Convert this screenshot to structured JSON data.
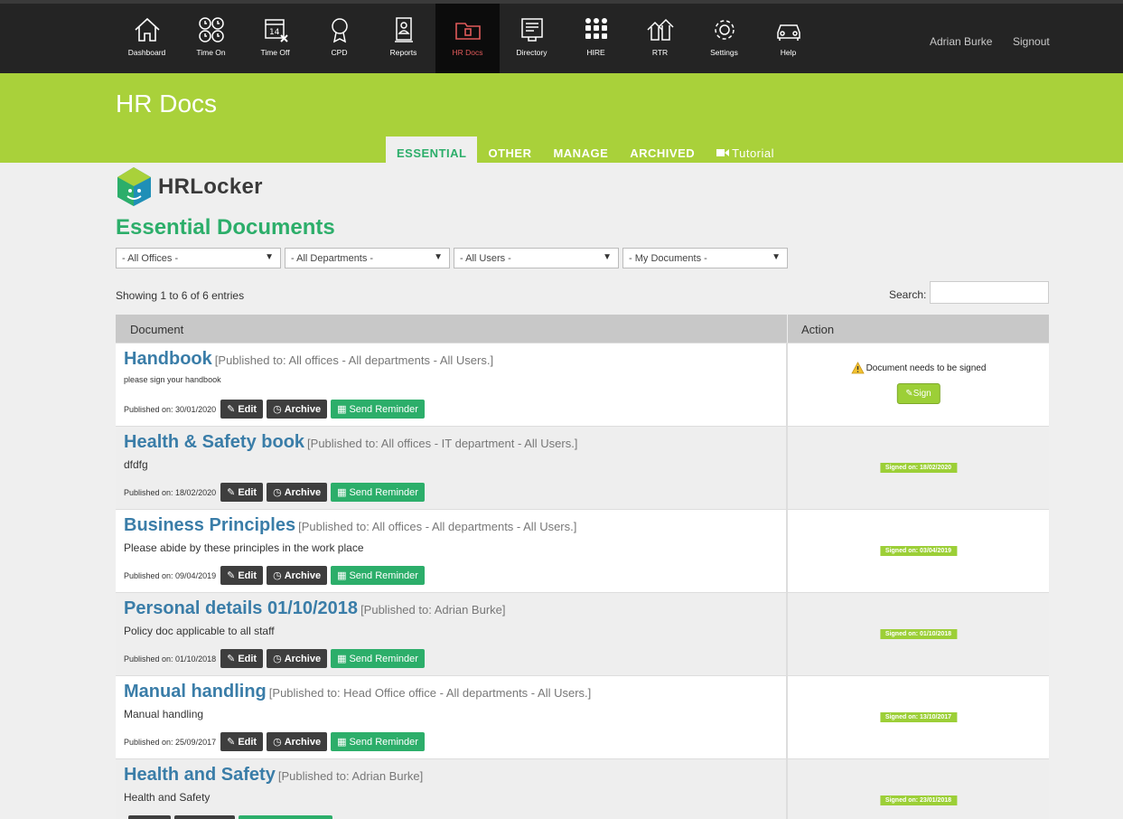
{
  "nav": {
    "items": [
      {
        "label": "Dashboard",
        "icon": "home-icon"
      },
      {
        "label": "Time On",
        "icon": "clock-icon"
      },
      {
        "label": "Time Off",
        "icon": "calendar-icon"
      },
      {
        "label": "CPD",
        "icon": "award-icon"
      },
      {
        "label": "Reports",
        "icon": "report-icon"
      },
      {
        "label": "HR Docs",
        "icon": "folder-icon"
      },
      {
        "label": "Directory",
        "icon": "directory-icon"
      },
      {
        "label": "HIRE",
        "icon": "people-icon"
      },
      {
        "label": "RTR",
        "icon": "houses-icon"
      },
      {
        "label": "Settings",
        "icon": "gear-icon"
      },
      {
        "label": "Help",
        "icon": "car-icon"
      }
    ],
    "active_index": 5,
    "active_color": "#e05a5a"
  },
  "user": {
    "name": "Adrian Burke",
    "signout": "Signout"
  },
  "header": {
    "title": "HR Docs",
    "bg_color": "#a9d13a",
    "tabs": [
      {
        "label": "ESSENTIAL",
        "active": true
      },
      {
        "label": "OTHER"
      },
      {
        "label": "MANAGE"
      },
      {
        "label": "ARCHIVED"
      },
      {
        "label": "Tutorial",
        "icon": "video-icon"
      }
    ]
  },
  "logo": {
    "text": "HRLocker"
  },
  "main": {
    "title": "Essential Documents",
    "filters": [
      "- All Offices -",
      "- All Departments -",
      "- All Users -",
      "- My Documents -"
    ],
    "showing": "Showing 1 to 6 of 6 entries",
    "search_label": "Search:",
    "search_value": "",
    "table": {
      "headers": [
        "Document",
        "Action"
      ],
      "edit_label": "Edit",
      "archive_label": "Archive",
      "reminder_label": "Send Reminder",
      "rows": [
        {
          "title": "Handbook",
          "published_to": "[Published to: All offices - All departments - All Users.]",
          "desc": "please sign your handbook",
          "published_on": "Published on: 30/01/2020",
          "action": "sign",
          "needs_text": "Document needs to be signed",
          "sign_label": "Sign"
        },
        {
          "title": "Health & Safety book",
          "published_to": "[Published to: All offices - IT department - All Users.]",
          "desc": "dfdfg",
          "published_on": "Published on: 18/02/2020",
          "action": "signed",
          "signed_text": "Signed on: 18/02/2020"
        },
        {
          "title": "Business Principles",
          "published_to": "[Published to: All offices - All departments - All Users.]",
          "desc": "Please abide by these principles in the work place",
          "published_on": "Published on: 09/04/2019",
          "action": "signed",
          "signed_text": "Signed on: 03/04/2019"
        },
        {
          "title": "Personal details 01/10/2018",
          "published_to": "[Published to: Adrian Burke]",
          "desc": "Policy doc applicable to all staff",
          "published_on": "Published on: 01/10/2018",
          "action": "signed",
          "signed_text": "Signed on: 01/10/2018"
        },
        {
          "title": "Manual handling",
          "published_to": "[Published to: Head Office office - All departments - All Users.]",
          "desc": "Manual handling",
          "published_on": "Published on: 25/09/2017",
          "action": "signed",
          "signed_text": "Signed on: 13/10/2017"
        },
        {
          "title": "Health and Safety",
          "published_to": "[Published to: Adrian Burke]",
          "desc": "Health and Safety",
          "published_on": "",
          "action": "signed",
          "signed_text": "Signed on: 23/01/2018"
        }
      ]
    }
  }
}
